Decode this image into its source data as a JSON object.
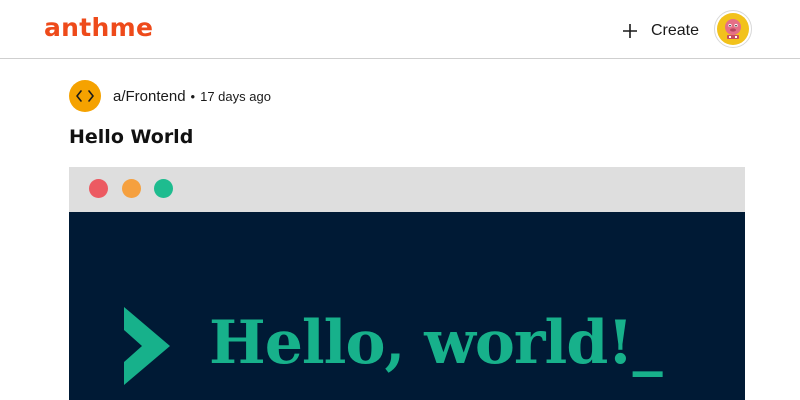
{
  "app": {
    "logo_text": "anthme"
  },
  "header": {
    "create_label": "Create",
    "create_icon": "plus-icon",
    "avatar_icon": "user-avatar"
  },
  "post": {
    "community_icon": "code-brackets-icon",
    "community_name": "a/Frontend",
    "separator": "•",
    "time_ago": "17 days ago",
    "title": "Hello World",
    "image": {
      "window_dots": [
        "red",
        "orange",
        "green"
      ],
      "text": "Hello, world!_",
      "colors": {
        "bar": "#dedede",
        "background": "#001a35",
        "accent": "#17b18b",
        "dot_red": "#ec5a62",
        "dot_orange": "#f5a03f",
        "dot_green": "#1ebc8f"
      }
    }
  },
  "colors": {
    "brand": "#ee4a1a",
    "community_badge": "#f5a200"
  }
}
